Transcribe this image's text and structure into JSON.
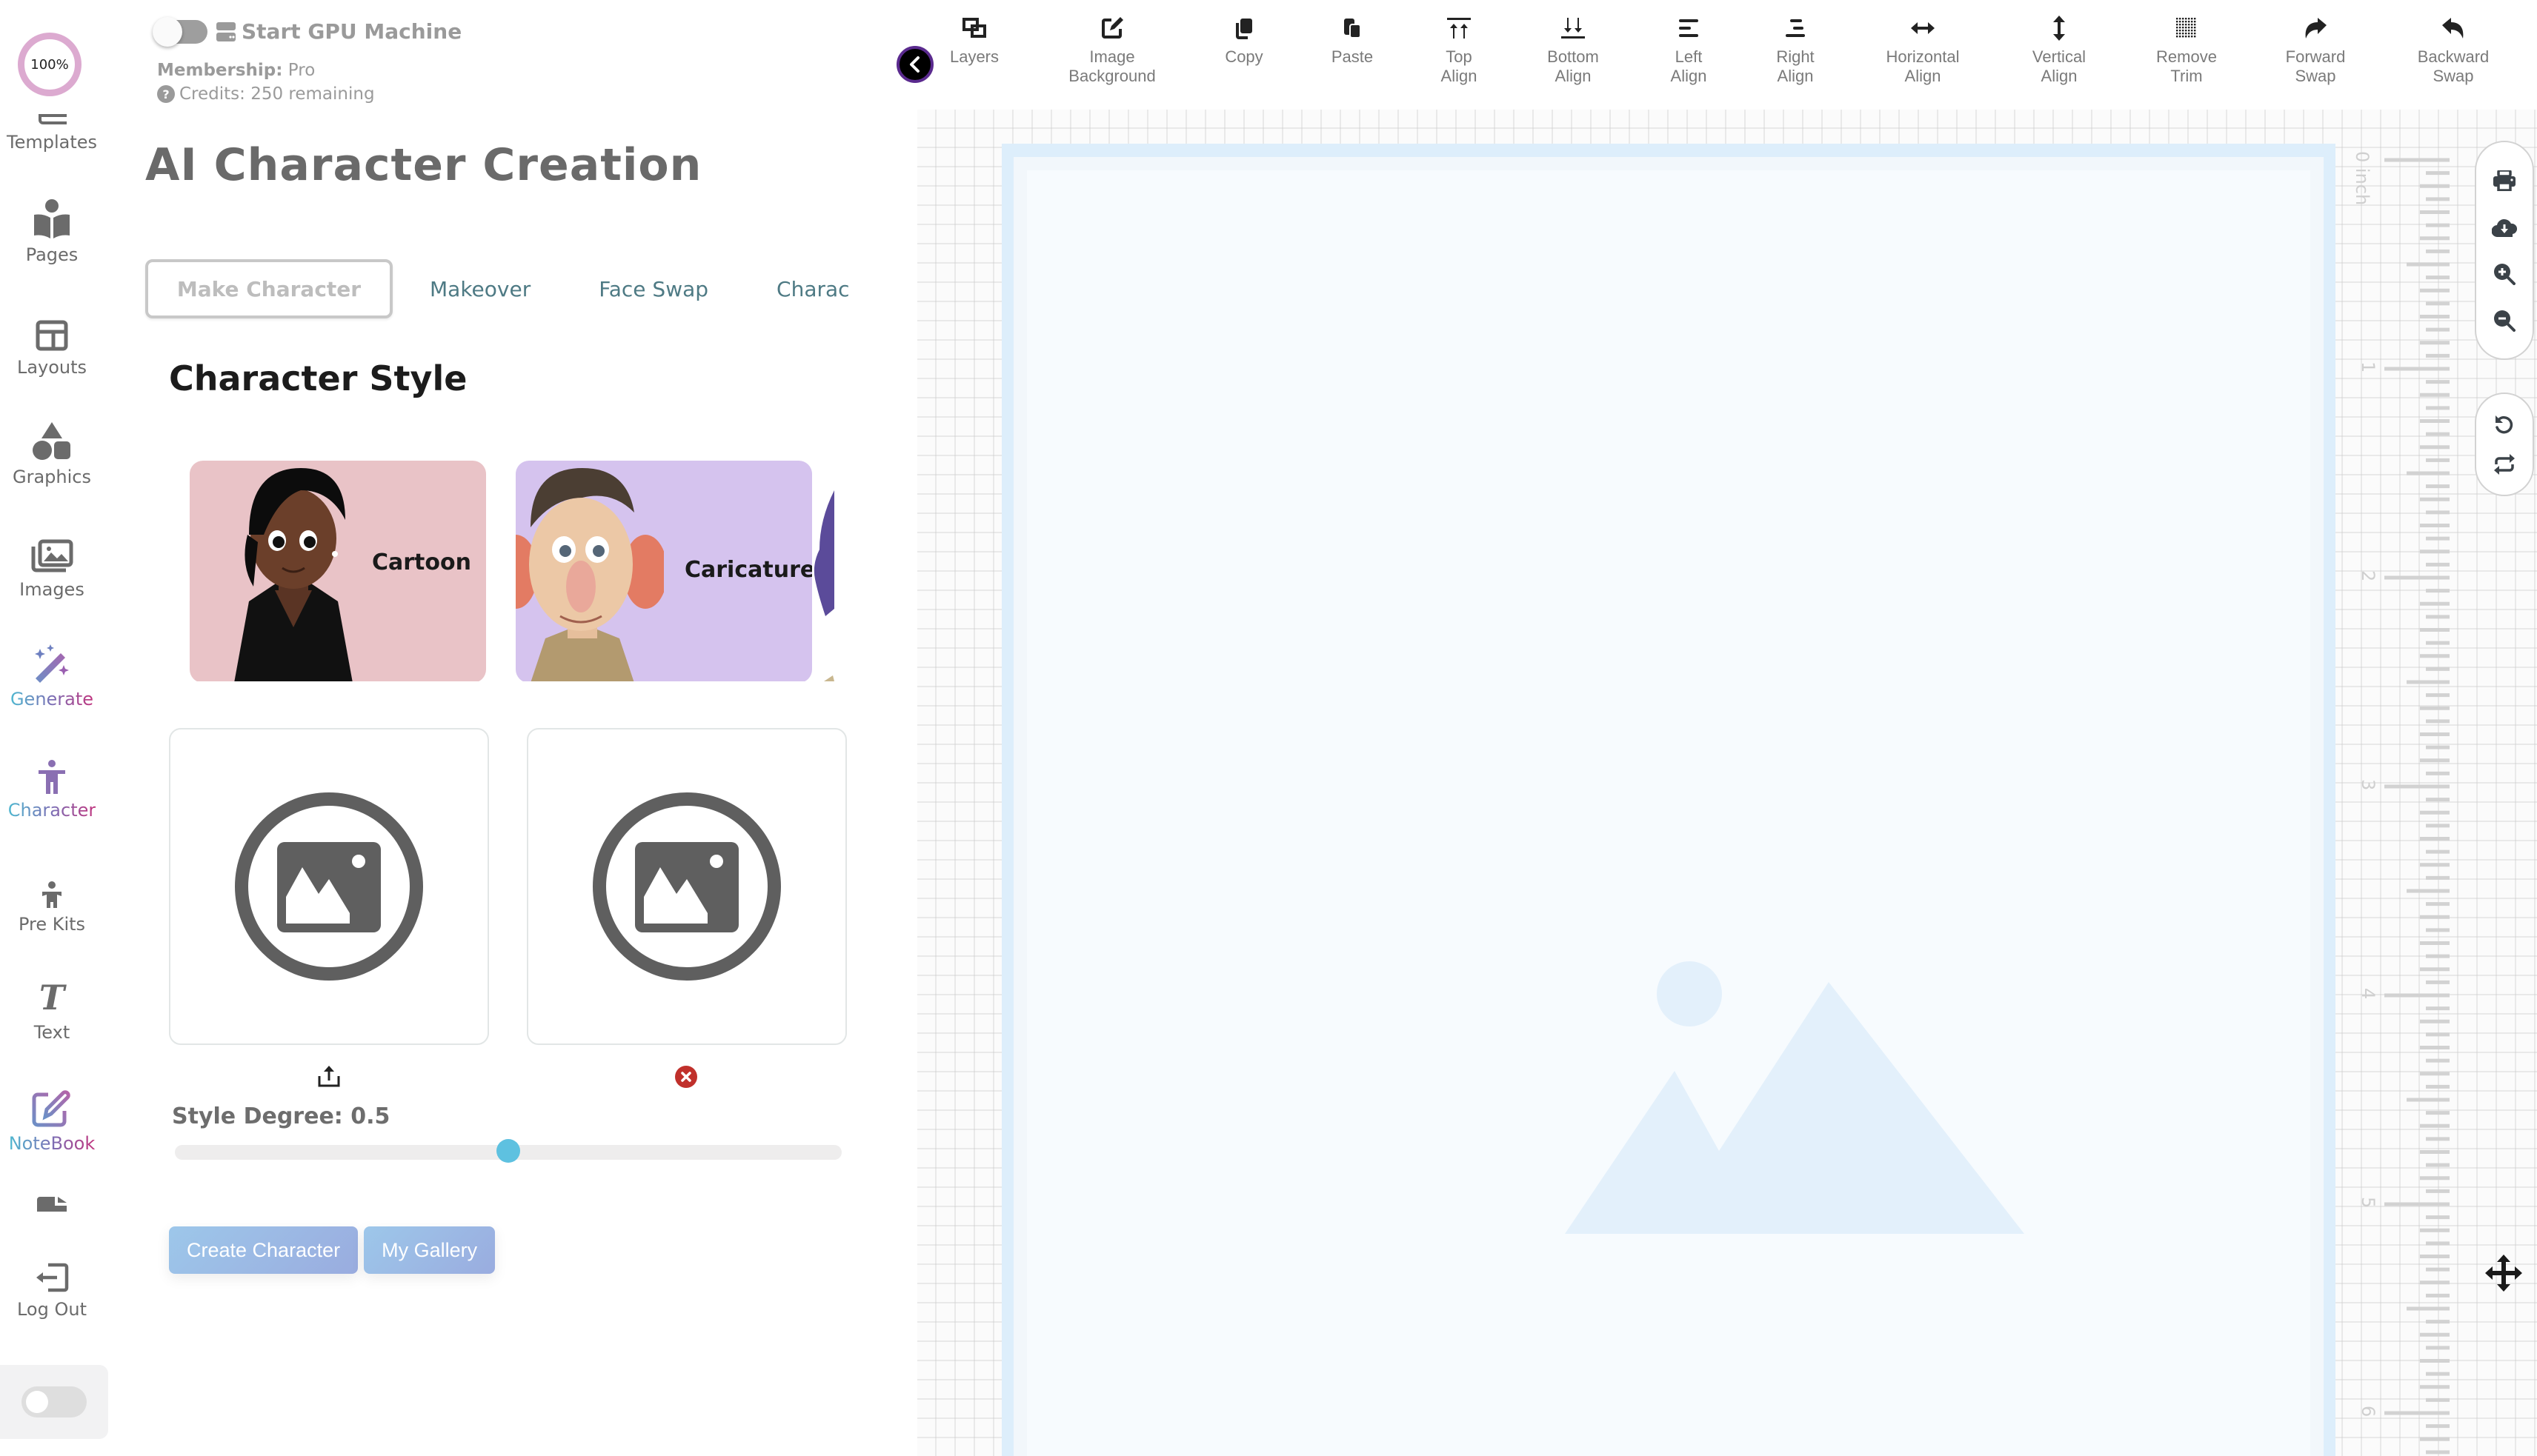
{
  "zoom_level": "100%",
  "sidebar": {
    "items": [
      {
        "label": "Templates",
        "icon": "templates-icon"
      },
      {
        "label": "Pages",
        "icon": "pages-icon"
      },
      {
        "label": "Layouts",
        "icon": "layouts-icon"
      },
      {
        "label": "Graphics",
        "icon": "graphics-icon"
      },
      {
        "label": "Images",
        "icon": "images-icon"
      },
      {
        "label": "Generate",
        "icon": "magic-wand-icon",
        "highlight": true
      },
      {
        "label": "Character",
        "icon": "character-icon",
        "highlight": true
      },
      {
        "label": "Pre Kits",
        "icon": "child-icon"
      },
      {
        "label": "Text",
        "icon": "text-icon"
      },
      {
        "label": "NoteBook",
        "icon": "notebook-icon",
        "highlight": true
      },
      {
        "label": "",
        "icon": "file-icon"
      },
      {
        "label": "Log Out",
        "icon": "logout-icon"
      }
    ],
    "dark_mode_toggle": false
  },
  "panel": {
    "gpu_toggle": false,
    "gpu_label": "Start GPU Machine",
    "membership_label": "Membership:",
    "membership_value": "Pro",
    "credits_text": "Credits: 250 remaining",
    "title": "AI Character Creation",
    "tabs": [
      {
        "label": "Make Character",
        "active": true
      },
      {
        "label": "Makeover"
      },
      {
        "label": "Face Swap"
      },
      {
        "label": "Charac"
      }
    ],
    "section_title": "Character Style",
    "styles": [
      {
        "name": "Cartoon",
        "bg": "#e9c3c7"
      },
      {
        "name": "Caricature",
        "bg": "#d5c3ee"
      }
    ],
    "style_degree_label": "Style Degree: 0.5",
    "style_degree_value": 0.5,
    "buttons": {
      "create": "Create Character",
      "gallery": "My Gallery"
    }
  },
  "toolbar": {
    "items": [
      {
        "label": "Layers",
        "icon": "layers-icon"
      },
      {
        "label": "Image\nBackground",
        "icon": "edit-icon"
      },
      {
        "label": "Copy",
        "icon": "copy-icon"
      },
      {
        "label": "Paste",
        "icon": "paste-icon"
      },
      {
        "label": "Top\nAlign",
        "icon": "align-top-icon"
      },
      {
        "label": "Bottom\nAlign",
        "icon": "align-bottom-icon"
      },
      {
        "label": "Left\nAlign",
        "icon": "align-left-icon"
      },
      {
        "label": "Right\nAlign",
        "icon": "align-right-icon"
      },
      {
        "label": "Horizontal\nAlign",
        "icon": "horizontal-arrows-icon"
      },
      {
        "label": "Vertical\nAlign",
        "icon": "vertical-arrows-icon"
      },
      {
        "label": "Remove\nTrim",
        "icon": "trim-grid-icon"
      },
      {
        "label": "Forward\nSwap",
        "icon": "forward-icon"
      },
      {
        "label": "Backward\nSwap",
        "icon": "backward-icon"
      }
    ]
  },
  "canvas": {
    "ruler_unit": "0 inch",
    "ruler_marks": [
      "1",
      "2",
      "3",
      "4",
      "5",
      "6"
    ]
  },
  "colors": {
    "accent_gradient_start": "#4fb8d0",
    "accent_gradient_end": "#c0337e",
    "slider_thumb": "#5ec1e0",
    "delete_red": "#c0302b",
    "zoom_ring": "#dcaad0"
  }
}
